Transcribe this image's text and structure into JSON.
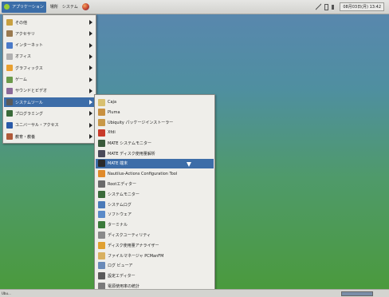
{
  "top_panel": {
    "apps_label": "アプリケーション",
    "places_label": "場所",
    "system_label": "システム",
    "clock": "08月03日(月) 13:42"
  },
  "main_menu": {
    "items": [
      {
        "label": "その他",
        "icon": "misc-icon",
        "color": "#c8a040"
      },
      {
        "label": "アクセサリ",
        "icon": "accessories-icon",
        "color": "#9a7a50"
      },
      {
        "label": "インターネット",
        "icon": "internet-icon",
        "color": "#4a7ac8"
      },
      {
        "label": "オフィス",
        "icon": "office-icon",
        "color": "#b0b0b0"
      },
      {
        "label": "グラフィックス",
        "icon": "graphics-icon",
        "color": "#e8a030"
      },
      {
        "label": "ゲーム",
        "icon": "games-icon",
        "color": "#6a9a4a"
      },
      {
        "label": "サウンドとビデオ",
        "icon": "sound-video-icon",
        "color": "#8a6a9a"
      },
      {
        "label": "システムツール",
        "icon": "system-tools-icon",
        "color": "#5a5a5a"
      },
      {
        "label": "プログラミング",
        "icon": "programming-icon",
        "color": "#3a6a3a"
      },
      {
        "label": "ユニバーサル・アクセス",
        "icon": "universal-access-icon",
        "color": "#2a5aa8"
      },
      {
        "label": "教育・教養",
        "icon": "education-icon",
        "color": "#b05a3a"
      }
    ],
    "selected_index": 7
  },
  "sub_menu": {
    "items": [
      {
        "label": "Caja",
        "icon": "caja-icon",
        "color": "#d8c070"
      },
      {
        "label": "Pluma",
        "icon": "pluma-icon",
        "color": "#c89040"
      },
      {
        "label": "Ubiquity パッケージインストーラー",
        "icon": "installer-icon",
        "color": "#c89848"
      },
      {
        "label": "Xfdi",
        "icon": "xfdi-icon",
        "color": "#c83a2a"
      },
      {
        "label": "MATE システムモニター",
        "icon": "system-monitor-icon",
        "color": "#3a5a3a"
      },
      {
        "label": "MATE ディスク使用量解析",
        "icon": "disk-usage-icon",
        "color": "#4a4a5a"
      },
      {
        "label": "MATE 端末",
        "icon": "terminal-icon",
        "color": "#2a2a2a"
      },
      {
        "label": "Nautilus-Actions Configuration Tool",
        "icon": "nautilus-actions-icon",
        "color": "#e08a2a"
      },
      {
        "label": "Rootエディター",
        "icon": "root-editor-icon",
        "color": "#6a6a6a"
      },
      {
        "label": "システムモニター",
        "icon": "monitor-icon",
        "color": "#3a6a3a"
      },
      {
        "label": "システムログ",
        "icon": "system-log-icon",
        "color": "#4a7ab8"
      },
      {
        "label": "ソフトウェア",
        "icon": "software-icon",
        "color": "#5a8ac8"
      },
      {
        "label": "ターミナル",
        "icon": "terminal2-icon",
        "color": "#3a7a3a"
      },
      {
        "label": "ディスクユーティリティ",
        "icon": "disk-utility-icon",
        "color": "#8a8a8a"
      },
      {
        "label": "ディスク使用量アナライザー",
        "icon": "disk-analyzer-icon",
        "color": "#e0a030"
      },
      {
        "label": "ファイルマネージャ PCManFM",
        "icon": "pcmanfm-icon",
        "color": "#d8b060"
      },
      {
        "label": "ログ ビューア",
        "icon": "log-viewer-icon",
        "color": "#6a8ab8"
      },
      {
        "label": "設定エディター",
        "icon": "config-editor-icon",
        "color": "#5a5a5a"
      },
      {
        "label": "電源使用率の統計",
        "icon": "power-stats-icon",
        "color": "#7a7a7a"
      }
    ],
    "selected_index": 6
  },
  "bottom_panel": {
    "label": "Ubu..."
  },
  "colors": {
    "selection": "#3d6da8",
    "menu_bg": "#efeeea"
  }
}
